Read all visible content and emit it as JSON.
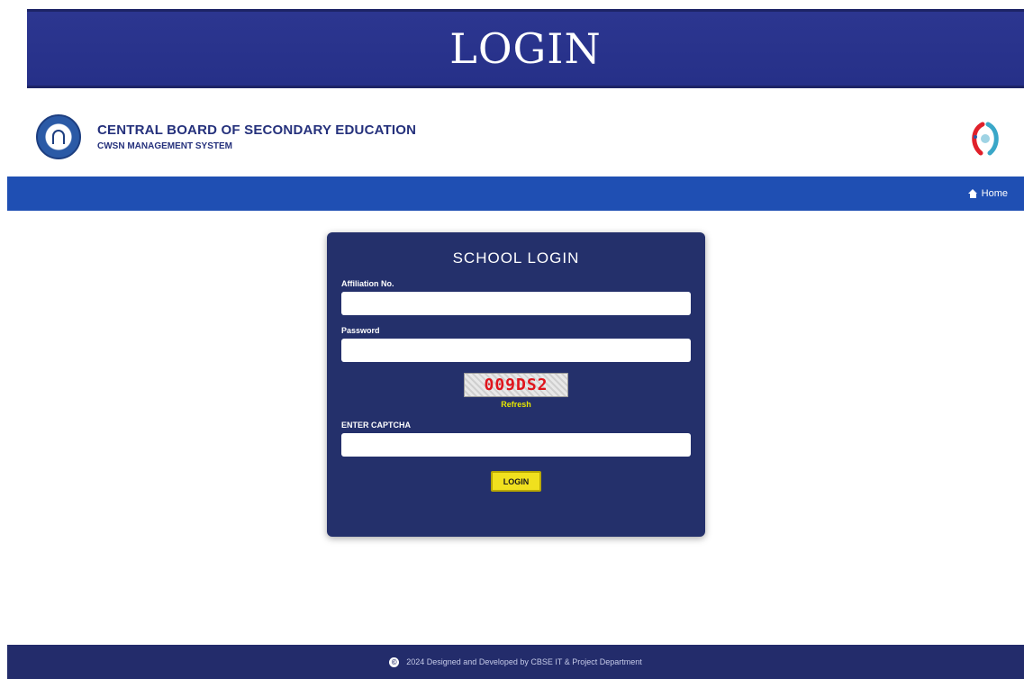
{
  "banner": {
    "title": "LOGIN"
  },
  "header": {
    "org_name": "CENTRAL BOARD OF SECONDARY EDUCATION",
    "system_name": "CWSN MANAGEMENT SYSTEM"
  },
  "nav": {
    "home_label": "Home",
    "home_icon": "home-icon"
  },
  "login": {
    "title": "SCHOOL LOGIN",
    "affiliation_label": "Affiliation No.",
    "affiliation_value": "",
    "password_label": "Password",
    "password_value": "",
    "captcha_text": "009DS2",
    "refresh_label": "Refresh",
    "captcha_label": "ENTER CAPTCHA",
    "captcha_value": "",
    "submit_label": "LOGIN"
  },
  "footer": {
    "copyright_icon": "copyright-icon",
    "text": "2024 Designed and Developed by CBSE IT & Project Department"
  },
  "colors": {
    "banner": "#2c3690",
    "nav_bar": "#1f4fb3",
    "card": "#24306b",
    "button": "#f0e01e",
    "refresh_link": "#e6e600",
    "captcha_text": "#e0141c",
    "footer": "#232c6b"
  }
}
